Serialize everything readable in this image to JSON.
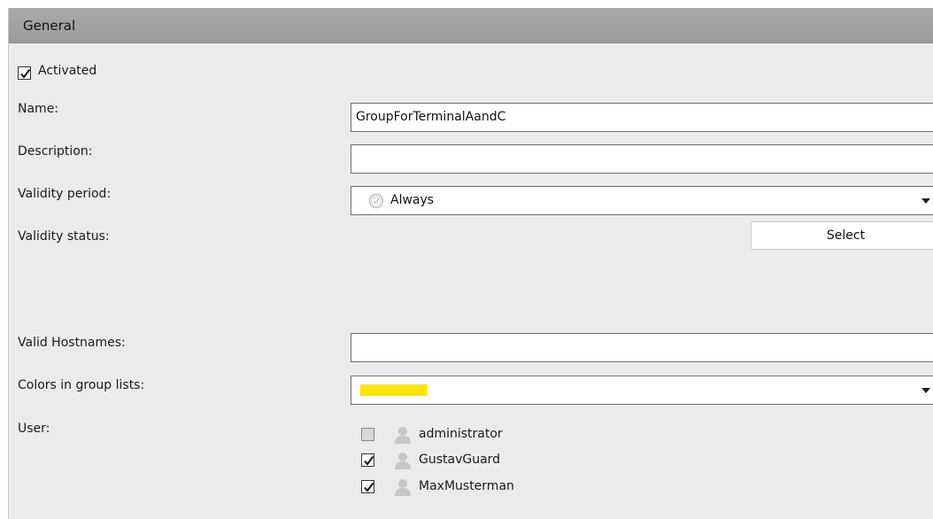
{
  "header": {
    "title": "General"
  },
  "activated": {
    "label": "Activated",
    "checked": true
  },
  "form": {
    "name": {
      "label": "Name:",
      "value": "GroupForTerminalAandC"
    },
    "description": {
      "label": "Description:",
      "value": ""
    },
    "validity_period": {
      "label": "Validity period:",
      "value": "Always",
      "icon": "clock-icon"
    },
    "validity_status": {
      "label": "Validity status:",
      "button_label": "Select"
    },
    "valid_hostnames": {
      "label": "Valid Hostnames:",
      "value": ""
    },
    "colors": {
      "label": "Colors in group lists:",
      "selected_color": "#ffe600"
    },
    "user": {
      "label": "User:",
      "items": [
        {
          "name": "administrator",
          "checked": false,
          "icon": "user-avatar-icon"
        },
        {
          "name": "GustavGuard",
          "checked": true,
          "icon": "user-avatar-icon"
        },
        {
          "name": "MaxMusterman",
          "checked": true,
          "icon": "user-avatar-icon"
        }
      ]
    }
  }
}
